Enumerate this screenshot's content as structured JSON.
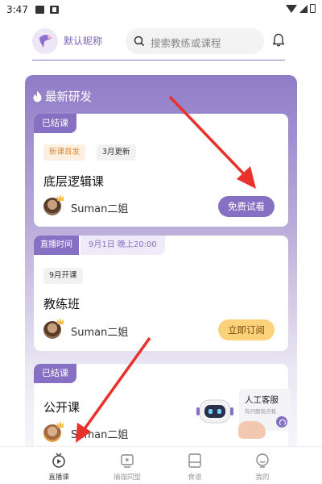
{
  "status_bar": {
    "time": "3:47"
  },
  "header": {
    "nickname": "默认昵称",
    "search_placeholder": "搜索教练或课程"
  },
  "section": {
    "title": "最新研发"
  },
  "cards": [
    {
      "status_tag": "已结课",
      "pills": [
        "新课首发",
        "3月更新"
      ],
      "title": "底层逻辑课",
      "teacher": "Suman二姐",
      "button": "免费试看"
    },
    {
      "live_label": "直播时间",
      "live_time": "9月1日 晚上20:00",
      "pill": "9月开课",
      "title": "教练班",
      "teacher": "Suman二姐",
      "button": "立即订阅"
    },
    {
      "status_tag": "已结课",
      "title": "公开课",
      "teacher": "Suman二姐"
    }
  ],
  "customer_service": {
    "title": "人工客服",
    "subtitle": "有问题就点我"
  },
  "bottom_nav": [
    {
      "label": "直播课",
      "icon": "live-course-icon",
      "active": true
    },
    {
      "label": "瑜珈同型",
      "icon": "video-icon",
      "active": false
    },
    {
      "label": "食谱",
      "icon": "recipe-icon",
      "active": false
    },
    {
      "label": "我的",
      "icon": "profile-icon",
      "active": false
    }
  ],
  "colors": {
    "accent": "#8670c3",
    "subscribe": "#fbd27a",
    "annotation_arrow": "#e8312a"
  }
}
